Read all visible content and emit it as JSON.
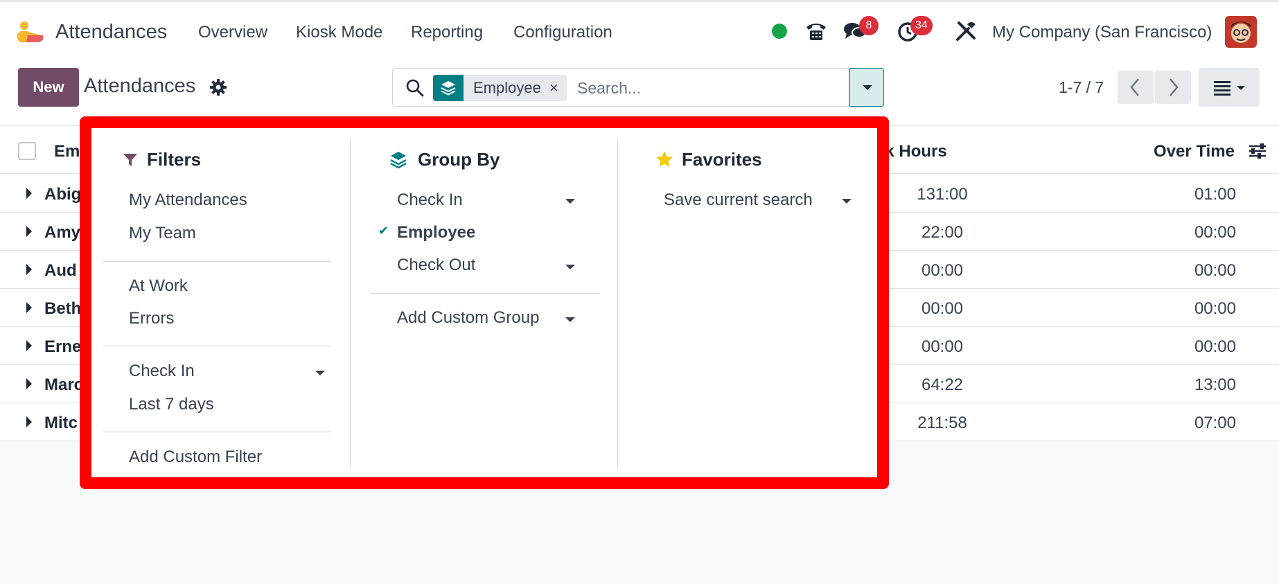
{
  "app": {
    "name": "Attendances",
    "menu": [
      "Overview",
      "Kiosk Mode",
      "Reporting",
      "Configuration"
    ],
    "company": "My Company (San Francisco)",
    "messages_badge": "8",
    "activities_badge": "34",
    "status_color": "#16a34a"
  },
  "control": {
    "new_label": "New",
    "title": "Attendances",
    "search": {
      "facet_label": "Employee",
      "facet_close": "×",
      "placeholder": "Search..."
    },
    "pager": "1-7 / 7"
  },
  "list": {
    "columns": {
      "employee": "Em",
      "work_hours": "rk Hours",
      "over_time": "Over Time"
    },
    "rows": [
      {
        "name": "Abig",
        "work": "131:00",
        "over": "01:00"
      },
      {
        "name": "Amy",
        "work": "22:00",
        "over": "00:00"
      },
      {
        "name": "Aud",
        "work": "00:00",
        "over": "00:00"
      },
      {
        "name": "Beth",
        "work": "00:00",
        "over": "00:00"
      },
      {
        "name": "Erne",
        "work": "00:00",
        "over": "00:00"
      },
      {
        "name": "Marc",
        "work": "64:22",
        "over": "13:00"
      },
      {
        "name": "Mitc",
        "work": "211:58",
        "over": "07:00"
      }
    ]
  },
  "dropdown": {
    "filters": {
      "heading": "Filters",
      "items": [
        "My Attendances",
        "My Team",
        "At Work",
        "Errors",
        "Check In",
        "Last 7 days",
        "Add Custom Filter"
      ]
    },
    "group_by": {
      "heading": "Group By",
      "items": [
        "Check In",
        "Employee",
        "Check Out",
        "Add Custom Group"
      ],
      "selected_mark": "✔"
    },
    "favorites": {
      "heading": "Favorites",
      "items": [
        "Save current search"
      ]
    }
  },
  "colors": {
    "brand": "#714b67",
    "teal": "#017e84",
    "highlight": "#ff0000",
    "badge": "#dc2d3b"
  }
}
